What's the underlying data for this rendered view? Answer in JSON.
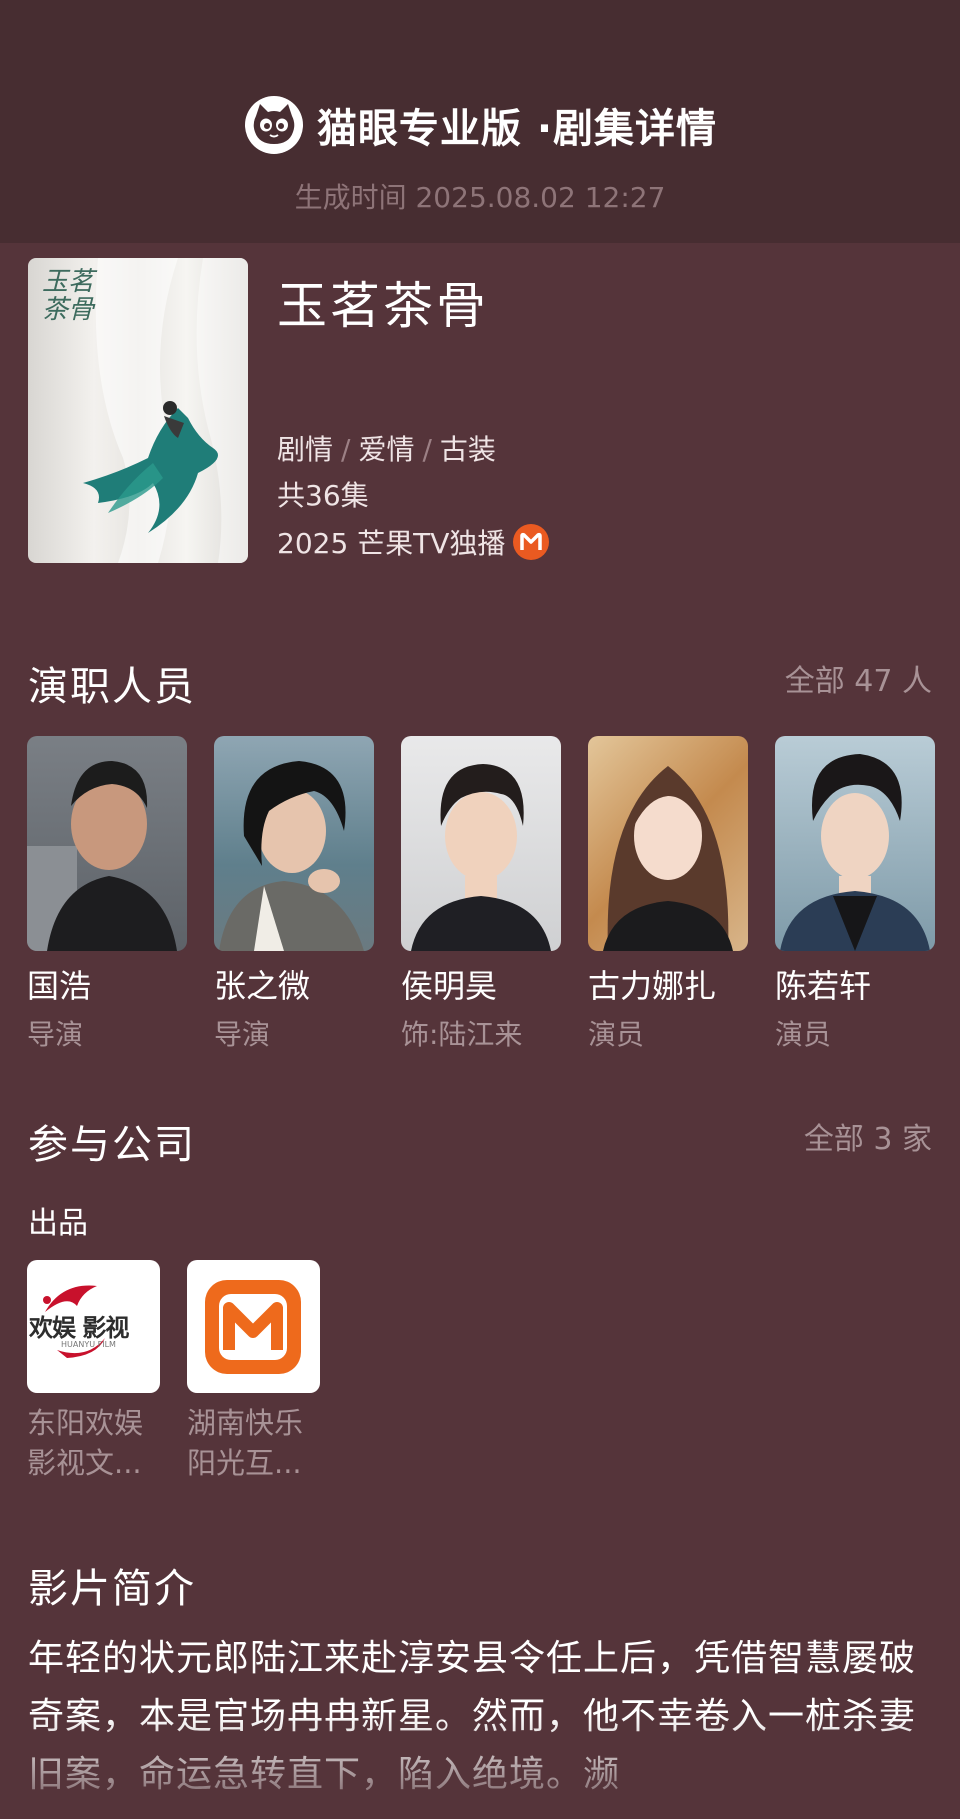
{
  "header": {
    "brand": "猫眼专业版 ·剧集详情",
    "generated": "生成时间 2025.08.02 12:27",
    "logo_icon": "cat-icon"
  },
  "show": {
    "title": "玉茗茶骨",
    "poster_title": "玉茗茶骨",
    "genres": [
      "剧情",
      "爱情",
      "古装"
    ],
    "genre_sep": "/",
    "episodes": "共36集",
    "release": "2025 芒果TV独播",
    "platform_icon": "mgtv-icon"
  },
  "cast_section": {
    "title": "演职人员",
    "more": "全部 47 人",
    "people": [
      {
        "name": "国浩",
        "role": "导演"
      },
      {
        "name": "张之微",
        "role": "导演"
      },
      {
        "name": "侯明昊",
        "role": "饰:陆江来"
      },
      {
        "name": "古力娜扎",
        "role": "演员"
      },
      {
        "name": "陈若轩",
        "role": "演员"
      }
    ]
  },
  "company_section": {
    "title": "参与公司",
    "more": "全部 3 家",
    "sub_label": "出品",
    "companies": [
      {
        "name_line1": "东阳欢娱",
        "name_line2": "影视文...",
        "logo_text": "欢娱 影视",
        "logo_sub": "HUANYU FILM"
      },
      {
        "name_line1": "湖南快乐",
        "name_line2": "阳光互...",
        "logo_text": "",
        "logo_sub": ""
      }
    ]
  },
  "synopsis_section": {
    "title": "影片简介",
    "text": "年轻的状元郎陆江来赴淳安县令任上后，凭借智慧屡破奇案，本是官场冉冉新星。然而，他不幸卷入一桩杀妻旧案，命运急转直下，陷入绝境。濒"
  },
  "colors": {
    "page_bg": "#55343a",
    "header_bg": "#472d31",
    "muted_text": "#a89296",
    "mgtv_orange": "#ea5a21"
  }
}
